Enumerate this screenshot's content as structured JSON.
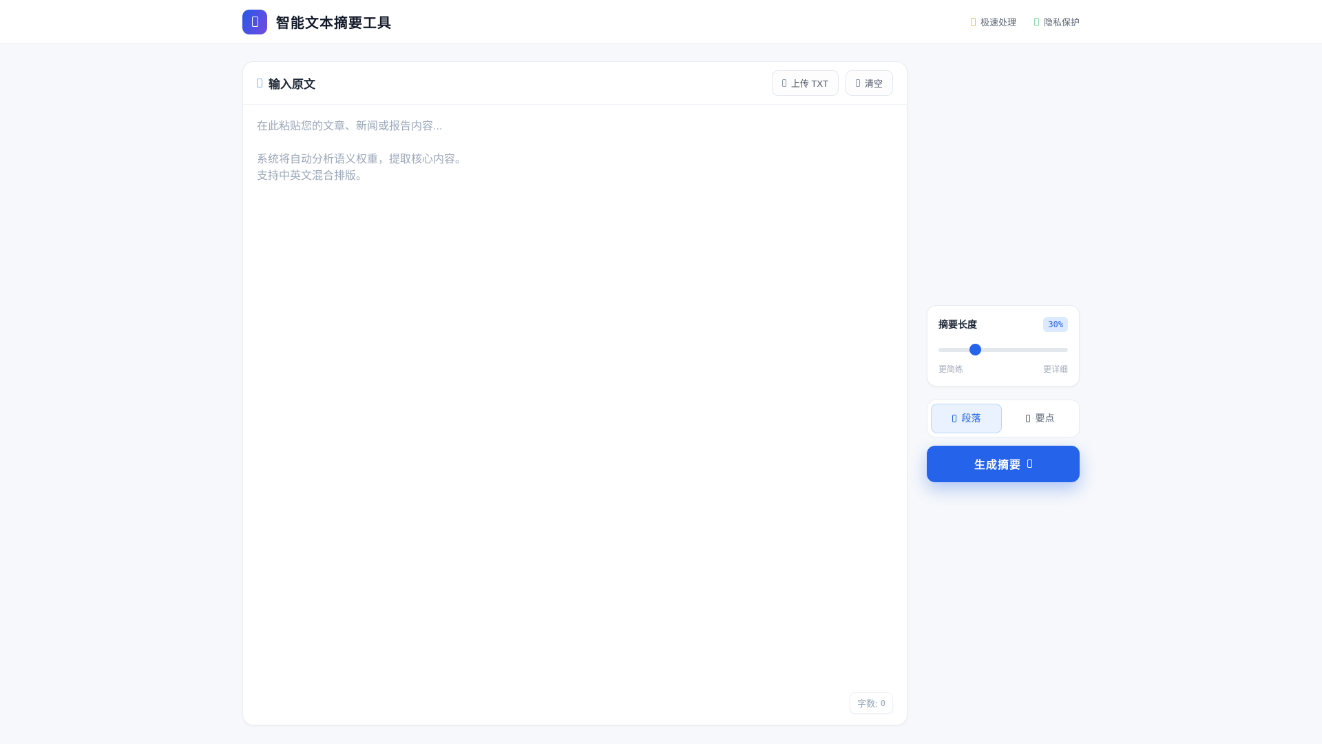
{
  "header": {
    "title": "智能文本摘要工具",
    "logo_icon": "document-sparkle-icon",
    "badges": [
      {
        "icon": "lightning-icon",
        "label": "极速处理",
        "color": "#f0c06a"
      },
      {
        "icon": "lock-icon",
        "label": "隐私保护",
        "color": "#86dca4"
      }
    ]
  },
  "input_card": {
    "title": "输入原文",
    "title_icon": "edit-icon",
    "upload_button": "上传 TXT",
    "upload_icon": "upload-icon",
    "clear_button": "清空",
    "clear_icon": "trash-icon",
    "textarea_value": "",
    "textarea_placeholder": "在此粘贴您的文章、新闻或报告内容...\n\n系统将自动分析语义权重，提取核心内容。\n支持中英文混合排版。",
    "char_count_label": "字数:",
    "char_count_value": "0"
  },
  "controls": {
    "length": {
      "label": "摘要长度",
      "value": "30%",
      "percent": 30,
      "slider_position_percent": 28,
      "min_label": "更简练",
      "max_label": "更详细"
    },
    "mode_toggle": {
      "options": [
        {
          "label": "段落",
          "icon": "paragraph-icon",
          "selected": true
        },
        {
          "label": "要点",
          "icon": "bullet-list-icon",
          "selected": false
        }
      ]
    },
    "generate_button": {
      "label": "生成摘要",
      "icon": "arrow-right-icon"
    }
  },
  "colors": {
    "accent": "#2563eb",
    "accent_light_bg": "#dbeafe",
    "logo_gradient_start": "#2e57e6",
    "logo_gradient_end": "#6c4ce0",
    "page_background": "#f6f8fb",
    "card_border": "#e9edf3",
    "muted_text": "#94a3b8"
  }
}
